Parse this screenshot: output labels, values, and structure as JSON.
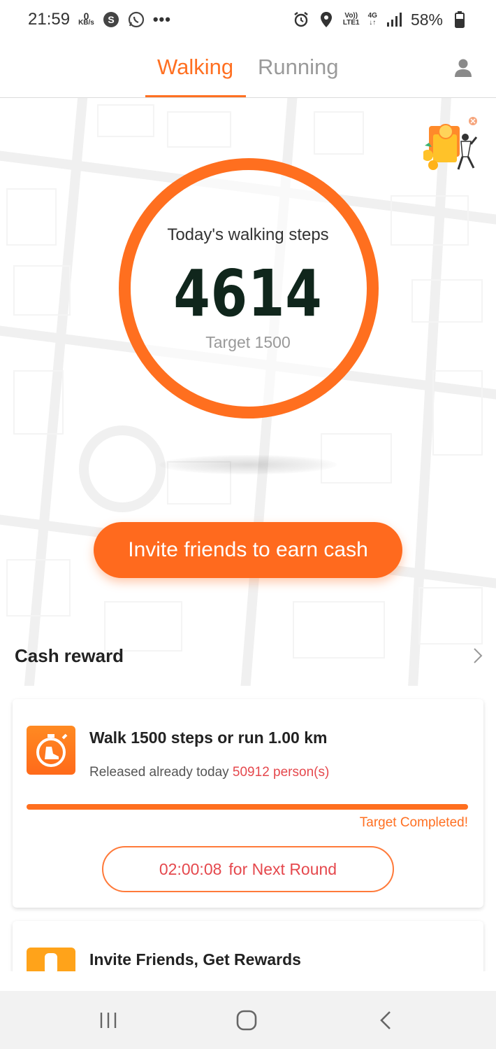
{
  "status_bar": {
    "time": "21:59",
    "speed_value": "0",
    "speed_unit": "KB/s",
    "dots": "•••",
    "network_top": "Vo))",
    "network_bottom": "LTE1",
    "network_type": "4G",
    "battery": "58%",
    "icons": [
      "s-circle-icon",
      "whatsapp-icon",
      "alarm-icon",
      "location-icon",
      "signal-icon",
      "battery-icon"
    ]
  },
  "tabs": {
    "items": [
      {
        "label": "Walking",
        "active": true
      },
      {
        "label": "Running",
        "active": false
      }
    ],
    "profile_icon": "person-icon"
  },
  "steps": {
    "label": "Today's walking steps",
    "value": "4614",
    "target": "Target 1500"
  },
  "invite_button": {
    "label": "Invite friends to earn cash"
  },
  "cash_reward": {
    "title": "Cash reward"
  },
  "cards": [
    {
      "title": "Walk 1500 steps or run 1.00 km",
      "sub_prefix": "Released already today",
      "sub_count": "50912 person(s)",
      "progress": 1.0,
      "status": "Target Completed!",
      "timer": "02:00:08",
      "timer_suffix": "for Next Round"
    },
    {
      "title": "Invite Friends, Get Rewards"
    }
  ],
  "colors": {
    "accent": "#ff6f1f",
    "steps_text": "#10261c",
    "highlight": "#e5484d"
  }
}
